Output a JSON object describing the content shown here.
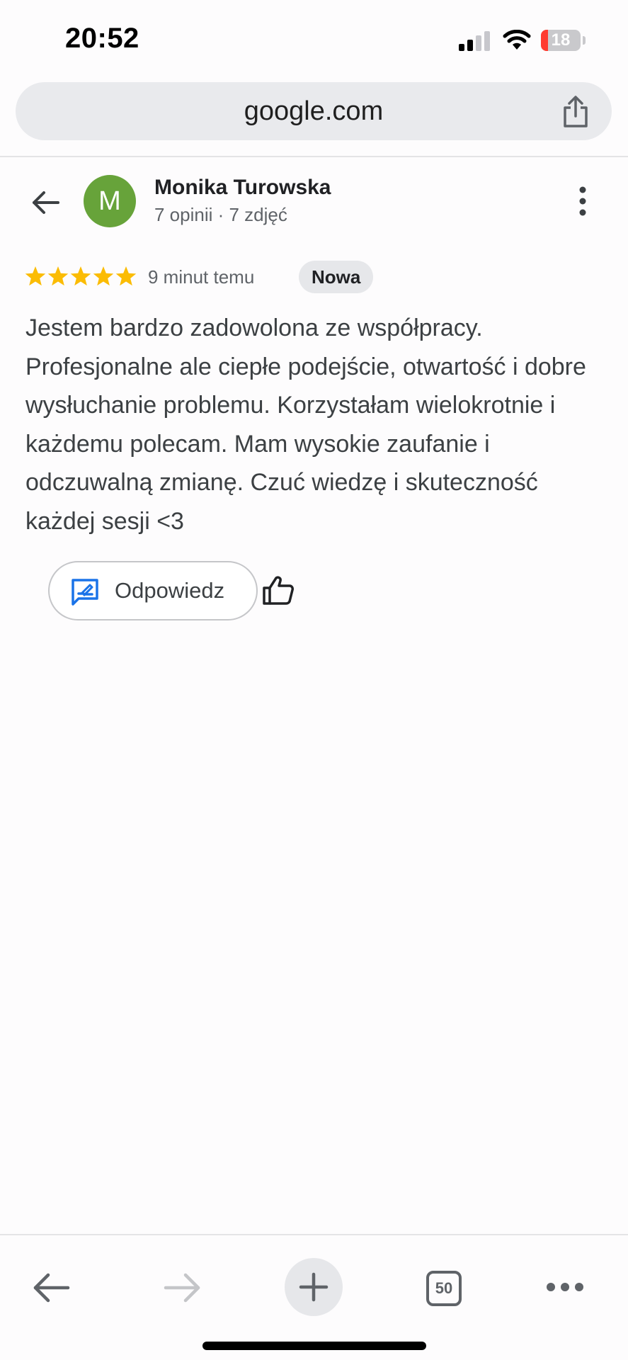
{
  "status_bar": {
    "time": "20:52",
    "battery_level": "18",
    "icons": [
      "signal-icon",
      "wifi-icon",
      "battery-icon"
    ]
  },
  "browser": {
    "url": "google.com",
    "share_icon": "share-icon"
  },
  "review": {
    "avatar_letter": "M",
    "avatar_color": "#67a33a",
    "reviewer_name": "Monika Turowska",
    "reviewer_meta": "7 opinii · 7 zdjęć",
    "rating": 5,
    "star_color": "#fbbc04",
    "time_ago": "9 minut temu",
    "badge": "Nowa",
    "text": "Jestem bardzo zadowolona ze współpracy. Profesjonalne ale ciepłe podejście, otwartość i dobre wysłuchanie problemu. Korzystałam wielokrotnie i każdemu polecam. Mam wysokie zaufanie i odczuwalną zmianę. Czuć wiedzę i skuteczność każdej sesji <3"
  },
  "actions": {
    "reply_label": "Odpowiedz",
    "reply_icon": "reply-icon",
    "like_icon": "thumbs-up-icon",
    "accent_color": "#1a73e8"
  },
  "bottom_nav": {
    "tab_count": "50",
    "icons": [
      "back-arrow-icon",
      "forward-arrow-icon",
      "plus-icon",
      "tabs-icon",
      "more-horizontal-icon"
    ]
  }
}
